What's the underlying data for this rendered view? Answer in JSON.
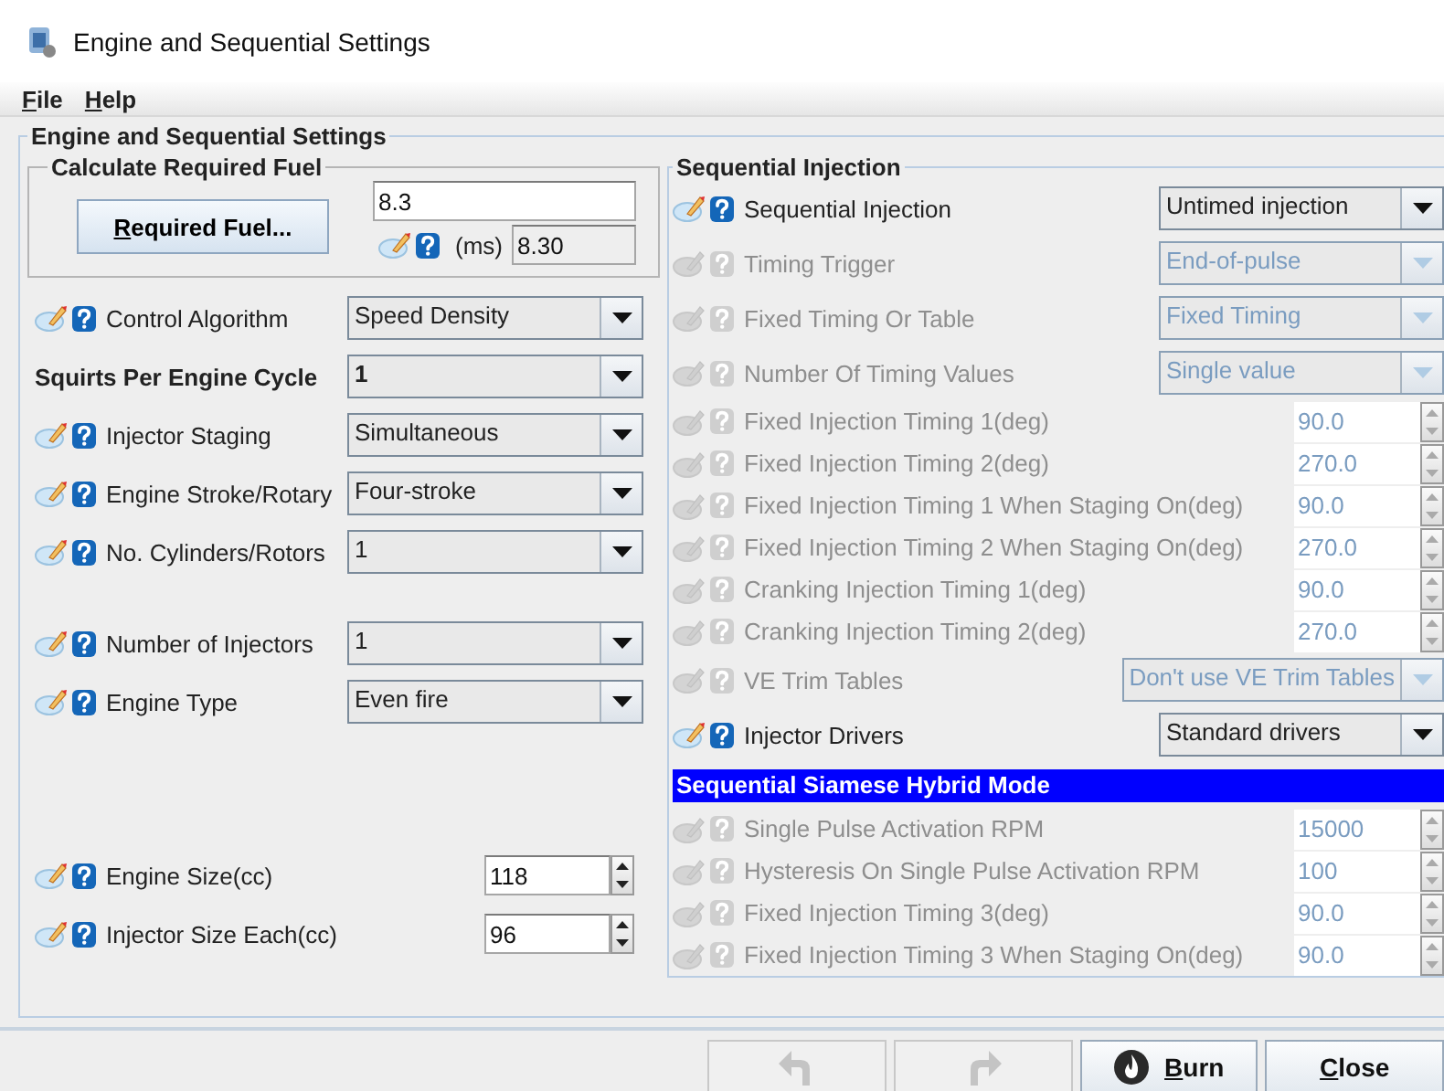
{
  "window": {
    "title": "Engine and Sequential Settings"
  },
  "menu": [
    {
      "label": "File"
    },
    {
      "label": "Help"
    }
  ],
  "panel_title": "Engine and Sequential Settings",
  "required_fuel": {
    "title": "Calculate Required Fuel",
    "button": "Required Fuel...",
    "value": "8.3",
    "unit": "(ms)",
    "computed": "8.30"
  },
  "left_groups": [
    [
      {
        "kind": "combo",
        "label": "Control Algorithm",
        "value": "Speed Density",
        "help": true,
        "emphasized": false
      },
      {
        "kind": "combo",
        "label": "Squirts Per Engine Cycle",
        "value": "1",
        "help": false,
        "emphasized": true
      },
      {
        "kind": "combo",
        "label": "Injector Staging",
        "value": "Simultaneous",
        "help": true,
        "emphasized": false
      },
      {
        "kind": "combo",
        "label": "Engine Stroke/Rotary",
        "value": "Four-stroke",
        "help": true,
        "emphasized": false
      },
      {
        "kind": "combo",
        "label": "No. Cylinders/Rotors",
        "value": "1",
        "help": true,
        "emphasized": false
      }
    ],
    [
      {
        "kind": "combo",
        "label": "Number of Injectors",
        "value": "1",
        "help": true,
        "emphasized": false
      },
      {
        "kind": "combo",
        "label": "Engine Type",
        "value": "Even fire",
        "help": true,
        "emphasized": false
      }
    ],
    [
      {
        "kind": "spinner",
        "label": "Engine Size(cc)",
        "value": "118",
        "help": true,
        "emphasized": false
      },
      {
        "kind": "spinner",
        "label": "Injector Size Each(cc)",
        "value": "96",
        "help": true,
        "emphasized": false
      }
    ]
  ],
  "sequential": {
    "title": "Sequential Injection",
    "rows": [
      {
        "kind": "combo",
        "label": "Sequential Injection",
        "value": "Untimed injection",
        "disabled": false
      },
      {
        "kind": "combo",
        "label": "Timing Trigger",
        "value": "End-of-pulse",
        "disabled": true
      },
      {
        "kind": "combo",
        "label": "Fixed Timing Or Table",
        "value": "Fixed Timing",
        "disabled": true
      },
      {
        "kind": "combo",
        "label": "Number Of Timing Values",
        "value": "Single value",
        "disabled": true
      },
      {
        "kind": "spinner",
        "label": "Fixed Injection Timing 1(deg)",
        "value": "90.0",
        "disabled": true
      },
      {
        "kind": "spinner",
        "label": "Fixed Injection Timing 2(deg)",
        "value": "270.0",
        "disabled": true
      },
      {
        "kind": "spinner",
        "label": "Fixed Injection Timing 1 When Staging On(deg)",
        "value": "90.0",
        "disabled": true
      },
      {
        "kind": "spinner",
        "label": "Fixed Injection Timing 2 When Staging On(deg)",
        "value": "270.0",
        "disabled": true
      },
      {
        "kind": "spinner",
        "label": "Cranking Injection Timing 1(deg)",
        "value": "90.0",
        "disabled": true
      },
      {
        "kind": "spinner",
        "label": "Cranking Injection Timing 2(deg)",
        "value": "270.0",
        "disabled": true
      },
      {
        "kind": "combo",
        "label": "VE Trim Tables",
        "value": "Don't use VE Trim Tables",
        "disabled": true
      },
      {
        "kind": "combo",
        "label": "Injector Drivers",
        "value": "Standard drivers",
        "disabled": false
      },
      {
        "kind": "header",
        "label": "Sequential Siamese Hybrid Mode"
      },
      {
        "kind": "spinner",
        "label": "Single Pulse Activation RPM",
        "value": "15000",
        "disabled": true
      },
      {
        "kind": "spinner",
        "label": "Hysteresis On Single Pulse Activation RPM",
        "value": "100",
        "disabled": true
      },
      {
        "kind": "spinner",
        "label": "Fixed Injection Timing 3(deg)",
        "value": "90.0",
        "disabled": true
      },
      {
        "kind": "spinner",
        "label": "Fixed Injection Timing 3 When Staging On(deg)",
        "value": "90.0",
        "disabled": true
      }
    ]
  },
  "buttons": [
    {
      "kind": "undo",
      "disabled": true
    },
    {
      "kind": "redo",
      "disabled": true
    },
    {
      "kind": "burn",
      "label": "Burn",
      "disabled": false
    },
    {
      "kind": "close",
      "label": "Close",
      "disabled": false
    }
  ]
}
